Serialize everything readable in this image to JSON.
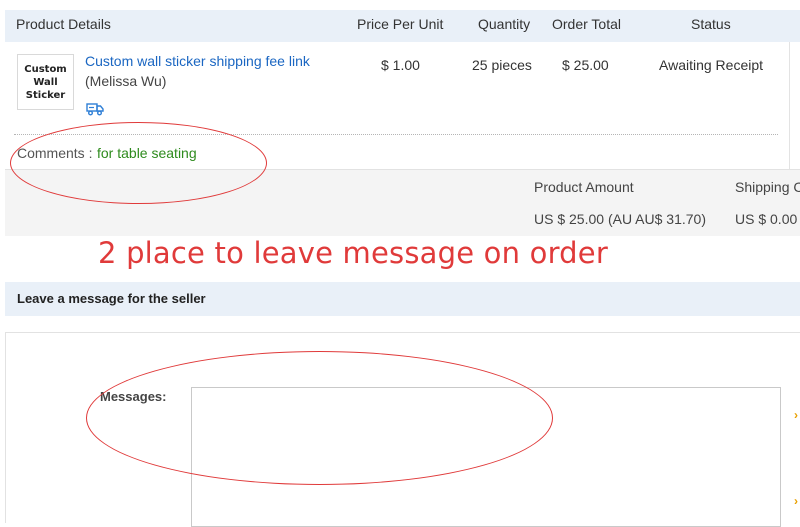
{
  "order_table": {
    "headers": {
      "product_details": "Product Details",
      "price_per_unit": "Price Per Unit",
      "quantity": "Quantity",
      "order_total": "Order Total",
      "status": "Status"
    },
    "item": {
      "image_text_line1": "Custom",
      "image_text_line2": "Wall Sticker",
      "product_name": "Custom wall sticker shipping fee link",
      "seller": "(Melissa Wu)",
      "price": "$ 1.00",
      "quantity": "25 pieces",
      "order_total": "$ 25.00",
      "status": "Awaiting Receipt"
    },
    "comments": {
      "label": "Comments :",
      "value": "for table seating"
    }
  },
  "summary": {
    "product_amount_label": "Product Amount",
    "product_amount_value": "US $ 25.00 (AU AU$ 31.70)",
    "shipping_label": "Shipping C",
    "shipping_value": "US $ 0.00"
  },
  "annotation": {
    "text": "2 place to leave message on order",
    "color": "#e03a3a"
  },
  "message_panel": {
    "title": "Leave a message for the seller",
    "label": "Messages:",
    "textarea_value": ""
  },
  "colors": {
    "header_bg": "#e9f0f8",
    "link": "#1a66c2",
    "comment_green": "#2e8b1d",
    "summary_bg": "#f4f4f4"
  }
}
